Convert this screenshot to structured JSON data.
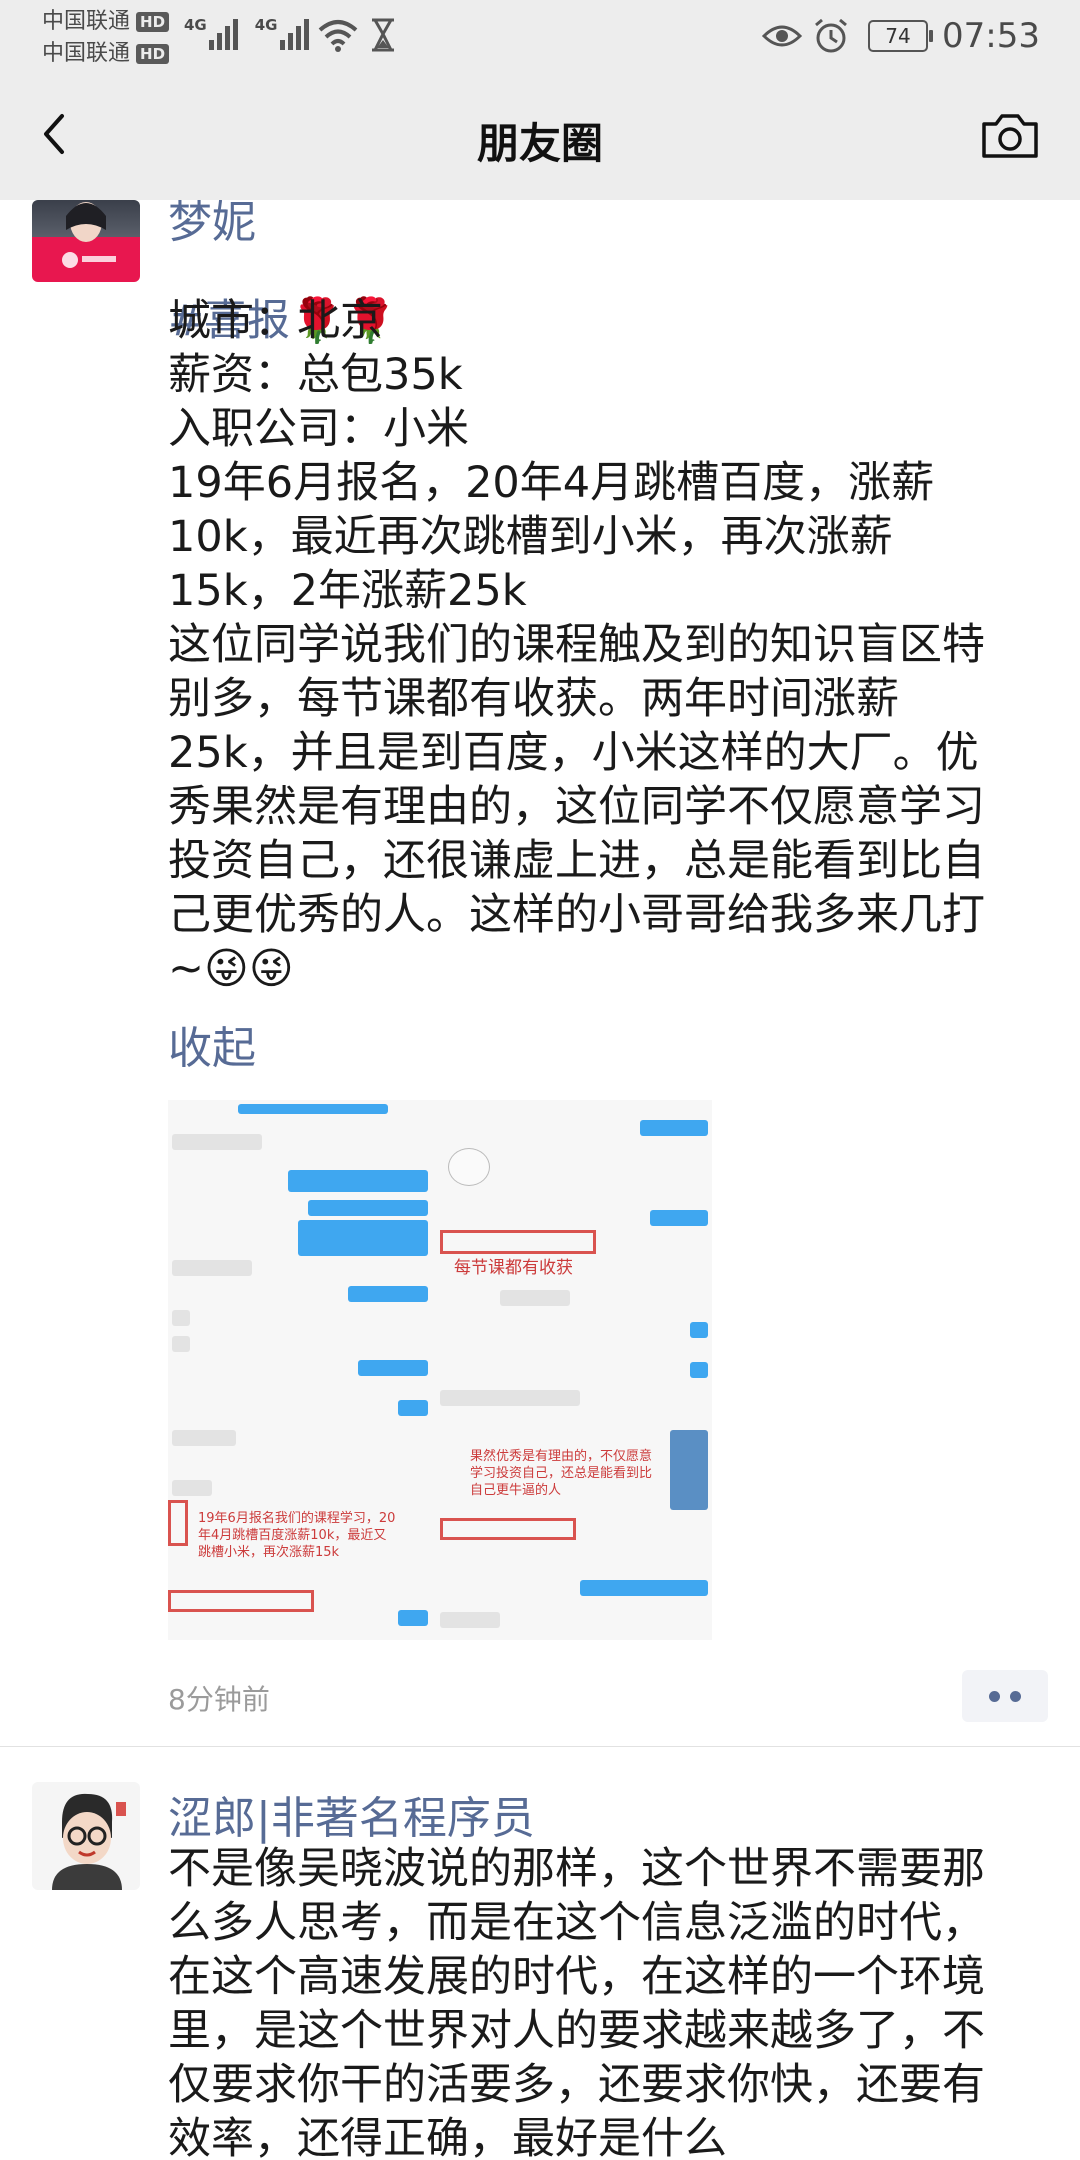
{
  "status_bar": {
    "carrier_1": "中国联通",
    "carrier_2": "中国联通",
    "hd_badge": "HD",
    "network_1": "4G",
    "network_2": "4G",
    "battery": "74",
    "time": "07:53"
  },
  "nav": {
    "title": "朋友圈"
  },
  "posts": [
    {
      "author": "梦妮",
      "hashtag": "#喜报",
      "emoji_tags": "🌹🌹",
      "body": "城市：北京\n薪资：总包35k\n入职公司：小米\n19年6月报名，20年4月跳槽百度，涨薪10k，最近再次跳槽到小米，再次涨薪15k，2年涨薪25k\n这位同学说我们的课程触及到的知识盲区特别多，每节课都有收获。两年时间涨薪25k，并且是到百度，小米这样的大厂。优秀果然是有理由的，这位同学不仅愿意学习投资自己，还很谦虚上进，总是能看到比自己更优秀的人。这样的小哥哥给我多来几打~😜😜",
      "collapse_label": "收起",
      "image_annotations": {
        "left": "19年6月报名我们的课程学习，20年4月跳槽百度涨薪10k，最近又跳槽小米，再次涨薪15k",
        "middle_top": "每节课都有收获",
        "middle_bottom": "果然优秀是有理由的，不仅愿意学习投资自己，还总是能看到比自己更牛逼的人"
      },
      "timestamp": "8分钟前"
    },
    {
      "author": "涩郎|非著名程序员",
      "body": "不是像吴晓波说的那样，这个世界不需要那么多人思考，而是在这个信息泛滥的时代，在这个高速发展的时代，在这样的一个环境里，是这个世界对人的要求越来越多了，不仅要求你干的活要多，还要求你快，还要有效率，还得正确，最好是什么"
    }
  ]
}
